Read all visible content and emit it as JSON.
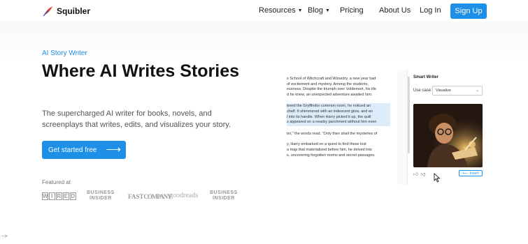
{
  "header": {
    "brand": "Squibler",
    "nav": [
      {
        "label": "Resources",
        "has_menu": true
      },
      {
        "label": "Blog",
        "has_menu": true
      },
      {
        "label": "Pricing",
        "has_menu": false
      },
      {
        "label": "About Us",
        "has_menu": false
      },
      {
        "label": "Log In",
        "has_menu": false
      }
    ],
    "signup_label": "Sign Up"
  },
  "hero": {
    "eyebrow": "AI Story Writer",
    "title": "Where AI Writes Stories",
    "subtitle": "The supercharged AI writer for books, novels, and screenplays that writes, edits, and visualizes your story.",
    "cta_label": "Get started free",
    "featured_label": "Featured at",
    "press": [
      {
        "name": "WIRED",
        "icon": "wired-logo"
      },
      {
        "name": "BUSINESS INSIDER",
        "icon": "business-insider-logo"
      },
      {
        "name": "FASTCOMPANY",
        "icon": "fastcompany-logo"
      },
      {
        "name": "goodreads",
        "icon": "goodreads-logo"
      },
      {
        "name": "BUSINESS INSIDER",
        "icon": "business-insider-logo"
      }
    ]
  },
  "mockup": {
    "doc_paragraphs": [
      [
        "s School of Witchcraft and Wizardry, a new year had",
        "of excitement and mystery. Among the students,",
        "essness. Despite the triumph over Voldemort, his life",
        "d he knew, an unexpected adventure awaited him."
      ],
      [
        "tered the Gryffindor common room, he noticed an",
        "shelf. It shimmered with an iridescent glow, and an",
        "l into its handle. When Harry picked it up, the quill",
        "s appeared on a nearby parchment without him even"
      ],
      [
        "ter,\" the words read. \"Only then shall the mysteries of"
      ],
      [
        "y, Harry embarked on a quest to find these lost",
        "a map that materialized before him, he delved into",
        "s, uncovering forgotten rooms and secret passages."
      ]
    ],
    "highlighted_paragraph": 1,
    "panel_title": "Smart Writer",
    "usecase_label": "Use case:",
    "usecase_value": "Visualize",
    "insert_label": "Insert",
    "accent": "#1e8fe6"
  },
  "stray_text": "-->"
}
